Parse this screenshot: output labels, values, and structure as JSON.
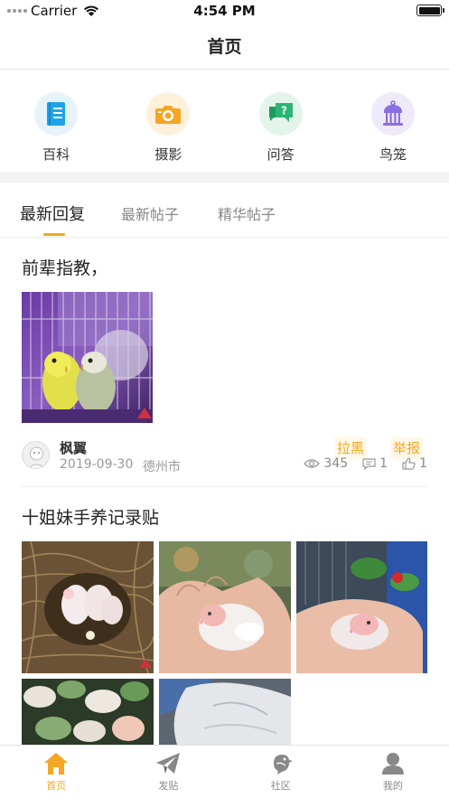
{
  "status_bar": {
    "carrier": "Carrier",
    "time": "4:54 PM"
  },
  "nav": {
    "title": "首页"
  },
  "categories": [
    {
      "label": "百科",
      "icon": "book-icon",
      "color": "#1fa3e8",
      "bg": "#e6f3fb"
    },
    {
      "label": "摄影",
      "icon": "camera-icon",
      "color": "#f5a623",
      "bg": "#fdf1dc"
    },
    {
      "label": "问答",
      "icon": "qa-bubble-icon",
      "color": "#2bb673",
      "bg": "#e3f4eb"
    },
    {
      "label": "鸟笼",
      "icon": "birdcage-icon",
      "color": "#8c6fe0",
      "bg": "#eeeafa"
    }
  ],
  "tabs": [
    {
      "label": "最新回复",
      "active": true
    },
    {
      "label": "最新帖子",
      "active": false
    },
    {
      "label": "精华帖子",
      "active": false
    }
  ],
  "posts": [
    {
      "title": "前辈指教，",
      "author": "枫翼",
      "date": "2019-09-30",
      "city": "德州市",
      "block_label": "拉黑",
      "report_label": "举报",
      "views": "345",
      "comments": "1",
      "likes": "1"
    },
    {
      "title": "十姐妹手养记录贴"
    }
  ],
  "tab_bar": [
    {
      "label": "首页",
      "icon": "home-icon",
      "active": true
    },
    {
      "label": "发贴",
      "icon": "paper-plane-icon",
      "active": false
    },
    {
      "label": "社区",
      "icon": "bird-icon",
      "active": false
    },
    {
      "label": "我的",
      "icon": "user-icon",
      "active": false
    }
  ],
  "colors": {
    "accent": "#f5a623",
    "text": "#222222",
    "muted": "#999999"
  }
}
